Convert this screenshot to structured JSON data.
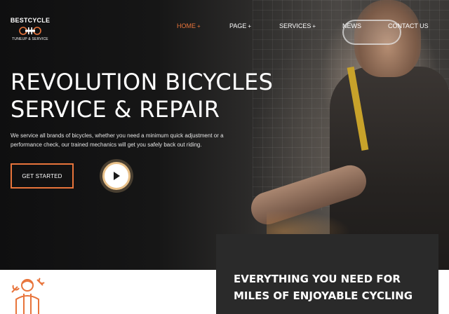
{
  "brand": {
    "name": "BESTCYCLE",
    "tagline": "TUNEUP & SERVICE",
    "logo_icon": "bicycle-wrench-icon",
    "accent_color": "#e8743b"
  },
  "nav": {
    "items": [
      {
        "label": "HOME",
        "has_submenu": true,
        "active": true
      },
      {
        "label": "PAGE",
        "has_submenu": true,
        "active": false
      },
      {
        "label": "SERVICES",
        "has_submenu": true,
        "active": false
      },
      {
        "label": "NEWS",
        "has_submenu": false,
        "active": false
      },
      {
        "label": "CONTACT US",
        "has_submenu": false,
        "active": false
      }
    ],
    "submenu_glyph": "+"
  },
  "hero": {
    "title_line1": "REVOLUTION BICYCLES",
    "title_line2": "SERVICE & REPAIR",
    "description": "We service all brands of bicycles, whether you need a minimum quick adjustment or a performance check, our trained mechanics will get you safely back out riding.",
    "cta_label": "GET STARTED",
    "play_icon": "play-icon"
  },
  "feature": {
    "icon": "mechanic-icon"
  },
  "info_card": {
    "title": "EVERYTHING YOU NEED FOR MILES OF ENJOYABLE CYCLING"
  }
}
